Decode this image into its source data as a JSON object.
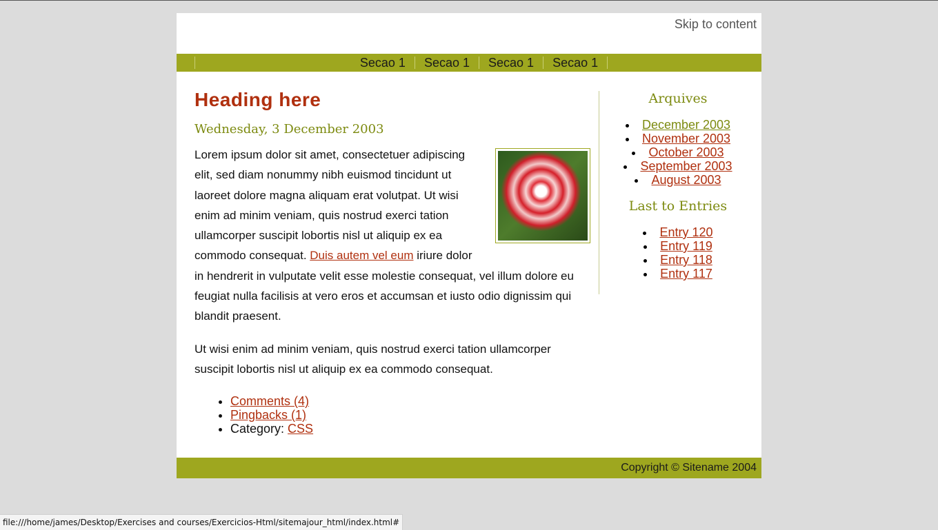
{
  "header": {
    "skip_link": "Skip to content"
  },
  "nav": {
    "items": [
      "Secao 1",
      "Secao 1",
      "Secao 1",
      "Secao 1"
    ]
  },
  "post": {
    "heading": "Heading here",
    "date": "Wednesday, 3 December 2003",
    "p1_before": "Lorem ipsum dolor sit amet, consectetuer adipiscing elit, sed diam nonummy nibh euismod tincidunt ut laoreet dolore magna aliquam erat volutpat. Ut wisi enim ad minim veniam, quis nostrud exerci tation ullamcorper suscipit lobortis nisl ut aliquip ex ea commodo consequat. ",
    "p1_link": "Duis autem vel eum",
    "p1_after": " iriure dolor in hendrerit in vulputate velit esse molestie consequat, vel illum dolore eu feugiat nulla facilisis at vero eros et accumsan et iusto odio dignissim qui blandit praesent.",
    "p2": "Ut wisi enim ad minim veniam, quis nostrud exerci tation ullamcorper suscipit lobortis nisl ut aliquip ex ea commodo consequat.",
    "comments": "Comments (4)",
    "pingbacks": "Pingbacks (1)",
    "category_label": "Category: ",
    "category": "CSS"
  },
  "sidebar": {
    "archives_title": "Arquives",
    "archives": [
      "December 2003",
      "November 2003",
      "October 2003",
      "September 2003",
      "August 2003"
    ],
    "entries_title": "Last to Entries",
    "entries": [
      "Entry 120",
      "Entry 119",
      "Entry 118",
      "Entry 117"
    ]
  },
  "footer": {
    "copyright": "Copyright © Sitename 2004"
  },
  "statusbar": {
    "url": "file:///home/james/Desktop/Exercises and courses/Exercicios-Html/sitemajour_html/index.html#"
  },
  "colors": {
    "accent": "#9ea71f",
    "link": "#b0300f",
    "olive_text": "#7c8a0f",
    "page_bg": "#dcdcdc"
  }
}
